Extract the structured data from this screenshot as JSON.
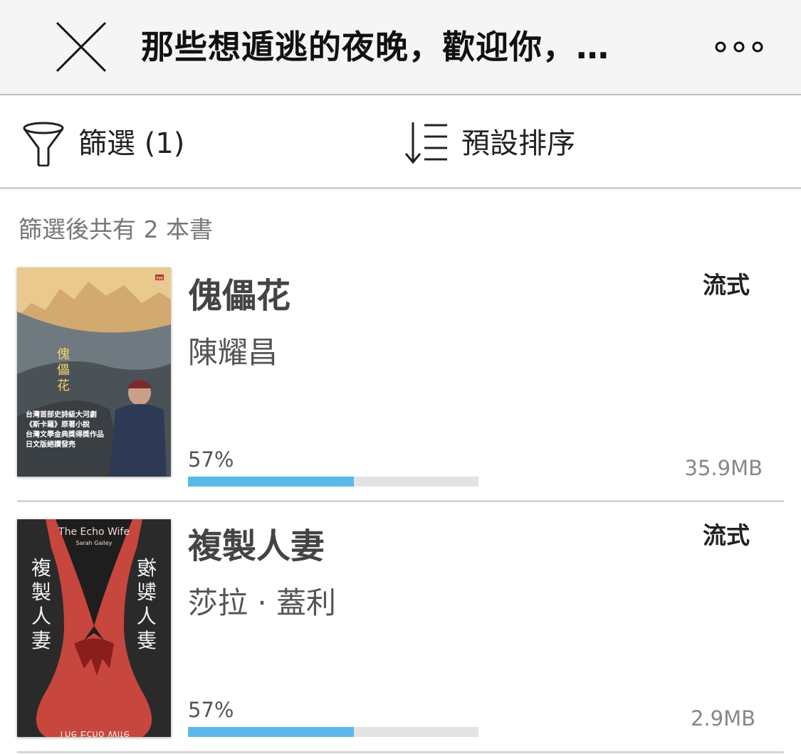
{
  "header": {
    "title": "那些想遁逃的夜晚，歡迎你，…",
    "close_icon": "close-icon",
    "more_icon": "more-icon"
  },
  "toolbar": {
    "filter_label": "篩選 (1)",
    "filter_icon": "funnel-icon",
    "sort_label": "預設排序",
    "sort_icon": "sort-icon"
  },
  "results": {
    "count_text": "篩選後共有 2 本書"
  },
  "books": [
    {
      "title": "傀儡花",
      "author": "陳耀昌",
      "format": "流式",
      "progress_text": "57%",
      "progress": 0.57,
      "size": "35.9MB",
      "cover": {
        "vertical_title": "傀\n儡\n花",
        "tagline": [
          "台灣首部史詩級大河劇",
          "《斯卡羅》原著小說",
          "台灣文學金典獎得獎作品",
          "日文版絕讚發売"
        ],
        "publisher_mark": "INK"
      }
    },
    {
      "title": "複製人妻",
      "author": "莎拉 · 蓋利",
      "format": "流式",
      "progress_text": "57%",
      "progress": 0.57,
      "size": "2.9MB",
      "cover": {
        "english_title": "The Echo Wife",
        "english_author": "Sarah Gailey",
        "vertical_title": "複\n製\n人\n妻"
      }
    }
  ],
  "colors": {
    "progress_fill": "#5ab9ea",
    "progress_track": "#e3e3e3",
    "header_bg": "#f5f5f5"
  }
}
